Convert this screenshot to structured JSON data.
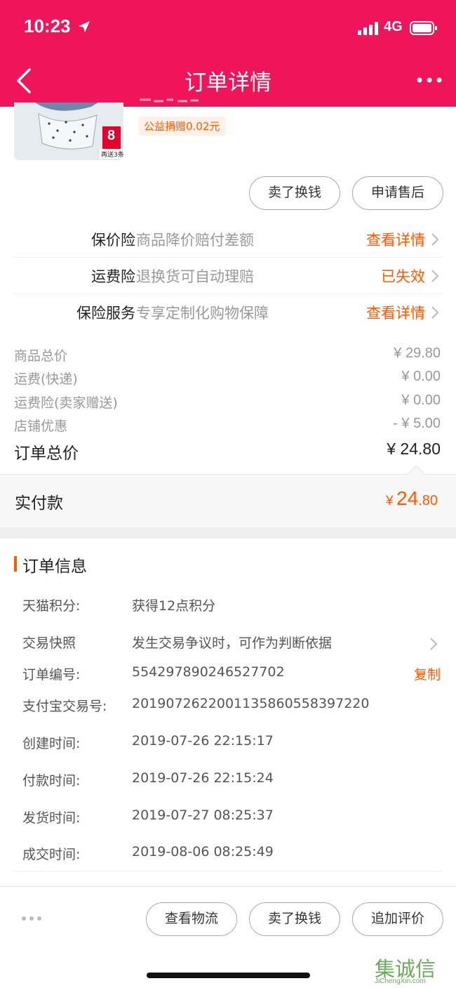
{
  "status_bar": {
    "time": "10:23",
    "network": "4G"
  },
  "header": {
    "title": "订单详情"
  },
  "product": {
    "donation": "公益捐赠0.02元",
    "badge_number": "8",
    "badge_bottom": "再送3条"
  },
  "item_actions": {
    "sell_button": "卖了换钱",
    "after_sales_button": "申请售后"
  },
  "insurance": [
    {
      "label": "保价险",
      "desc": "商品降价赔付差额",
      "action": "查看详情"
    },
    {
      "label": "运费险",
      "desc": "退换货可自动理赔",
      "action": "已失效"
    },
    {
      "label": "保险服务",
      "desc": "专享定制化购物保障",
      "action": "查看详情"
    }
  ],
  "fees": [
    {
      "label": "商品总价",
      "value": "¥ 29.80"
    },
    {
      "label": "运费(快递)",
      "value": "¥ 0.00"
    },
    {
      "label": "运费险(卖家赠送)",
      "value": "¥ 0.00"
    },
    {
      "label": "店铺优惠",
      "value": "- ¥ 5.00"
    }
  ],
  "order_total": {
    "label": "订单总价",
    "value": "¥ 24.80"
  },
  "paid": {
    "label": "实付款",
    "currency": "¥",
    "integer": "24",
    "decimal": ".80"
  },
  "order_info": {
    "title": "订单信息",
    "rows": [
      {
        "label": "天猫积分:",
        "value": "获得12点积分"
      },
      {
        "label": "交易快照",
        "value": "发生交易争议时，可作为判断依据"
      },
      {
        "label": "订单编号:",
        "value": "554297890246527702",
        "action": "复制"
      },
      {
        "label": "支付宝交易号:",
        "value": "2019072622001135860558397220"
      },
      {
        "label": "创建时间:",
        "value": "2019-07-26 22:15:17"
      },
      {
        "label": "付款时间:",
        "value": "2019-07-26 22:15:24"
      },
      {
        "label": "发货时间:",
        "value": "2019-07-27 08:25:37"
      },
      {
        "label": "成交时间:",
        "value": "2019-08-06 08:25:49"
      }
    ]
  },
  "footer": {
    "logistics_button": "查看物流",
    "sell_button": "卖了换钱",
    "review_button": "追加评价"
  },
  "watermark": {
    "text": "集诚信",
    "sub": "JiChengXin.com"
  },
  "colors": {
    "brand": "#f0145a",
    "accent": "#ff5a00"
  }
}
